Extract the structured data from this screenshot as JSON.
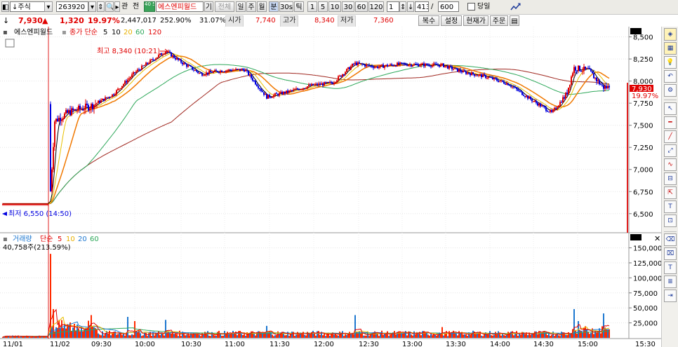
{
  "toolbar": {
    "market": "주식",
    "code": "263920",
    "btn_search": "관",
    "btn_prev": "전",
    "green_btn": "40 50",
    "stock_name": "에스엔피월드",
    "btn_gi": "기",
    "btn_all": "전체",
    "periods": [
      "일",
      "주",
      "월",
      "분",
      "30s",
      "틱"
    ],
    "intervals": [
      "1",
      "5",
      "10",
      "30",
      "60",
      "120"
    ],
    "count": "1",
    "position": "413",
    "slash": "/",
    "total": "600",
    "today_label": "당일"
  },
  "info": {
    "price": "7,930",
    "arrow": "▲",
    "change": "1,320",
    "change_pct": "19.97%",
    "volume": "2,447,017",
    "vol_ratio": "252.90%",
    "turnover": "31.07%",
    "open_label": "시가",
    "open": "7,740",
    "high_label": "고가",
    "high": "8,340",
    "low_label": "저가",
    "low": "7,360",
    "buttons": [
      "복수",
      "설정",
      "현재가",
      "주문"
    ],
    "menu_icon": "grid-icon"
  },
  "price_panel": {
    "stock_name": "에스엔피월드",
    "ma_label": "종가 단순",
    "ma_periods": [
      "5",
      "10",
      "20",
      "60",
      "120"
    ],
    "high_annotation": "최고 8,340 (10:21)",
    "low_annotation": "최저 6,550 (14:50)",
    "current_price": "7,930",
    "current_pct": "19.97%"
  },
  "volume_panel": {
    "label": "거래량",
    "ma_label": "단순",
    "ma_periods": [
      "5",
      "10",
      "20",
      "60"
    ],
    "current_volume": "40,758주(213.59%)"
  },
  "colors": {
    "up": "#e00000",
    "down": "#0000e0",
    "ma5": "#000000",
    "ma10": "#e8c000",
    "ma20": "#f07800",
    "ma60": "#2ea85a",
    "ma120": "#a02820",
    "vol_up": "#ff2a00",
    "vol_down": "#1e78d0"
  },
  "chart_data": [
    {
      "type": "candlestick",
      "title": "에스엔피월드 (263920) 1분봉",
      "x_tick_labels": [
        "11/01",
        "11/02",
        "09:30",
        "10:00",
        "10:30",
        "11:00",
        "11:30",
        "12:00",
        "12:30",
        "13:00",
        "13:30",
        "14:00",
        "14:30",
        "15:00",
        "15:30"
      ],
      "y_tick_labels": [
        "8,500",
        "8,250",
        "8,000",
        "7,750",
        "7,500",
        "7,250",
        "7,000",
        "6,750",
        "6,500"
      ],
      "ylim": [
        6300,
        8600
      ],
      "previous_close": 6610,
      "open": 7740,
      "high": 8340,
      "low": 7360,
      "close": 7930,
      "price_path": [
        {
          "t": "11/01",
          "v": 6600
        },
        {
          "t": "11/02",
          "v": 6620
        },
        {
          "t": "09:05",
          "v": 7550
        },
        {
          "t": "09:15",
          "v": 7650
        },
        {
          "t": "09:30",
          "v": 7720
        },
        {
          "t": "09:45",
          "v": 7850
        },
        {
          "t": "10:00",
          "v": 8100
        },
        {
          "t": "10:10",
          "v": 8220
        },
        {
          "t": "10:21",
          "v": 8340
        },
        {
          "t": "10:30",
          "v": 8230
        },
        {
          "t": "10:45",
          "v": 8080
        },
        {
          "t": "11:00",
          "v": 8120
        },
        {
          "t": "11:15",
          "v": 8130
        },
        {
          "t": "11:30",
          "v": 7820
        },
        {
          "t": "11:45",
          "v": 7880
        },
        {
          "t": "12:00",
          "v": 7950
        },
        {
          "t": "12:15",
          "v": 7980
        },
        {
          "t": "12:30",
          "v": 8200
        },
        {
          "t": "12:45",
          "v": 8160
        },
        {
          "t": "13:00",
          "v": 8190
        },
        {
          "t": "13:30",
          "v": 8180
        },
        {
          "t": "13:45",
          "v": 8100
        },
        {
          "t": "14:00",
          "v": 8050
        },
        {
          "t": "14:15",
          "v": 7970
        },
        {
          "t": "14:30",
          "v": 7800
        },
        {
          "t": "14:45",
          "v": 7640
        },
        {
          "t": "14:55",
          "v": 7850
        },
        {
          "t": "15:00",
          "v": 8150
        },
        {
          "t": "15:10",
          "v": 8120
        },
        {
          "t": "15:20",
          "v": 7930
        }
      ],
      "series": [
        {
          "name": "5",
          "type": "ma"
        },
        {
          "name": "10",
          "type": "ma"
        },
        {
          "name": "20",
          "type": "ma"
        },
        {
          "name": "60",
          "type": "ma"
        },
        {
          "name": "120",
          "type": "ma"
        }
      ],
      "annotations": [
        "최고 8,340 (10:21)",
        "최저 6,550 (14:50)"
      ]
    },
    {
      "type": "bar",
      "title": "거래량",
      "y_tick_labels": [
        "150,000",
        "125,000",
        "100,000",
        "75,000",
        "50,000",
        "25,000"
      ],
      "ylim": [
        0,
        160000
      ],
      "spikes": [
        {
          "t": "11/02 09:00",
          "v": 140000
        },
        {
          "t": "09:04",
          "v": 48000
        },
        {
          "t": "09:30",
          "v": 38000
        },
        {
          "t": "09:55",
          "v": 35000
        },
        {
          "t": "10:00",
          "v": 28000
        },
        {
          "t": "10:21",
          "v": 30000
        },
        {
          "t": "11:30",
          "v": 20000
        },
        {
          "t": "12:30",
          "v": 38000
        },
        {
          "t": "13:30",
          "v": 18000
        },
        {
          "t": "15:00",
          "v": 48000
        },
        {
          "t": "15:03",
          "v": 28000
        },
        {
          "t": "15:20",
          "v": 40758
        }
      ],
      "series": [
        {
          "name": "5",
          "type": "ma"
        },
        {
          "name": "10",
          "type": "ma"
        },
        {
          "name": "20",
          "type": "ma"
        },
        {
          "name": "60",
          "type": "ma"
        }
      ]
    }
  ]
}
